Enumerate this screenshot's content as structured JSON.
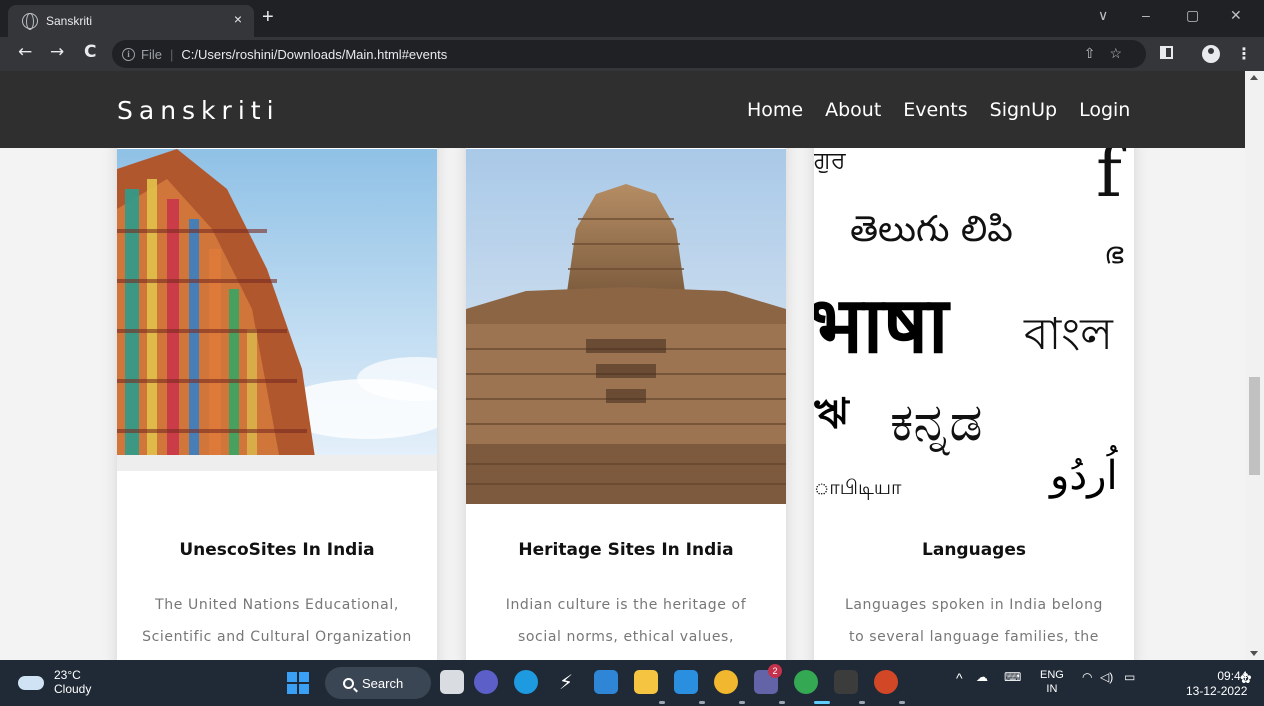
{
  "browser": {
    "tab_title": "Sanskriti",
    "tab_close": "×",
    "new_tab": "+",
    "back": "←",
    "forward": "→",
    "reload": "C",
    "url_scheme": "File",
    "url_separator": "|",
    "url": "C:/Users/roshini/Downloads/Main.html#events",
    "window_controls": {
      "chevron": "∨",
      "minimize": "–",
      "restore": "▢",
      "close": "✕"
    },
    "omnibox_icons": {
      "share": "⇧",
      "bookmark": "☆"
    },
    "menu": "⋮"
  },
  "site": {
    "brand": "Sanskriti",
    "nav": [
      "Home",
      "About",
      "Events",
      "SignUp",
      "Login"
    ]
  },
  "cards": [
    {
      "title": "UnescoSites In India",
      "text": "The United Nations Educational, Scientific and Cultural Organization (UNESCO) designates",
      "image": "temple-gopuram"
    },
    {
      "title": "Heritage Sites In India",
      "text": "Indian culture is the heritage of social norms, ethical values, traditional customs, belief",
      "image": "ancient-temple"
    },
    {
      "title": "Languages",
      "text": "Languages spoken in India belong to several language families, the major ones being the Indo",
      "image": "indian-scripts",
      "scripts": [
        "ਗੁਰ",
        "f",
        "తెలుగు లిపి",
        "ഭ",
        "भाषा",
        "বাংল",
        "ঋ",
        "ಕನ್ನಡ",
        "ாபிடியா",
        "اُردُو"
      ]
    }
  ],
  "taskbar": {
    "temperature": "23°C",
    "weather": "Cloudy",
    "search": "Search",
    "teams_badge": "2",
    "lang_top": "ENG",
    "lang_bottom": "IN",
    "time": "09:44",
    "date": "13-12-2022"
  },
  "colors": {
    "navbar": "#2f2f2f",
    "chrome_dark": "#202124",
    "chrome_toolbar": "#35363a",
    "taskbar": "#1f2a36",
    "card_bg": "#ffffff",
    "text_muted": "#777777"
  }
}
